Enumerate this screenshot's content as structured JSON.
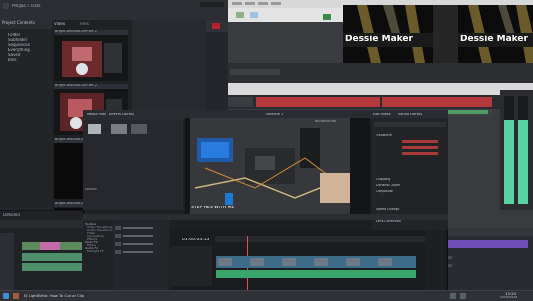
{
  "left_window": {
    "top_tab": "PROJECT Tests",
    "panel_title": "Project Contents",
    "tab_video": "Video",
    "tab_files": "Files",
    "tree": [
      "Folder",
      "Subfolder",
      "Sequences",
      "Everything",
      "Saved",
      "Bins"
    ],
    "clips": [
      "bright-arduino-cliff-eff-1",
      "bright-arduino-cliff-eff-2",
      "bright-arduino-cliff-eff-3",
      "bright-arduino-cliff-eff-4",
      "bright-arduino-cliff-eff-5"
    ],
    "bottom_label": "Detailed"
  },
  "right_window": {
    "preview_left_text": "Dessie Maker",
    "preview_right_text": "Dessie Maker"
  },
  "resolve": {
    "tabs": [
      "Media Pool",
      "Effects Library",
      "Edit Index",
      "Sound Library"
    ],
    "viewer_label": "Timeline 1",
    "viewer_timecode": "00:00:00:00",
    "overlay_text": "STEP HES WITH ME",
    "bins_header": "Master",
    "timeline_timecode": "01:00:03:13",
    "lib_items": [
      "Toolbox",
      "Video Transitions",
      "Audio Transitions",
      "Titles",
      "Generators",
      "Effects",
      "Open FX",
      "Filters",
      "Audio FX",
      "Fairlight FX"
    ],
    "inspector_sections": [
      "Transform",
      "Cropping",
      "Dynamic Zoom",
      "Composite",
      "Speed Change",
      "Stabilization",
      "Lens Correction",
      "Retime and Scaling",
      "Image Scaling"
    ]
  },
  "taskbar": {
    "task_title": "EJ LightBrite: How To Cut or Clip",
    "clock": "13:24",
    "date": "10/25/2018"
  }
}
